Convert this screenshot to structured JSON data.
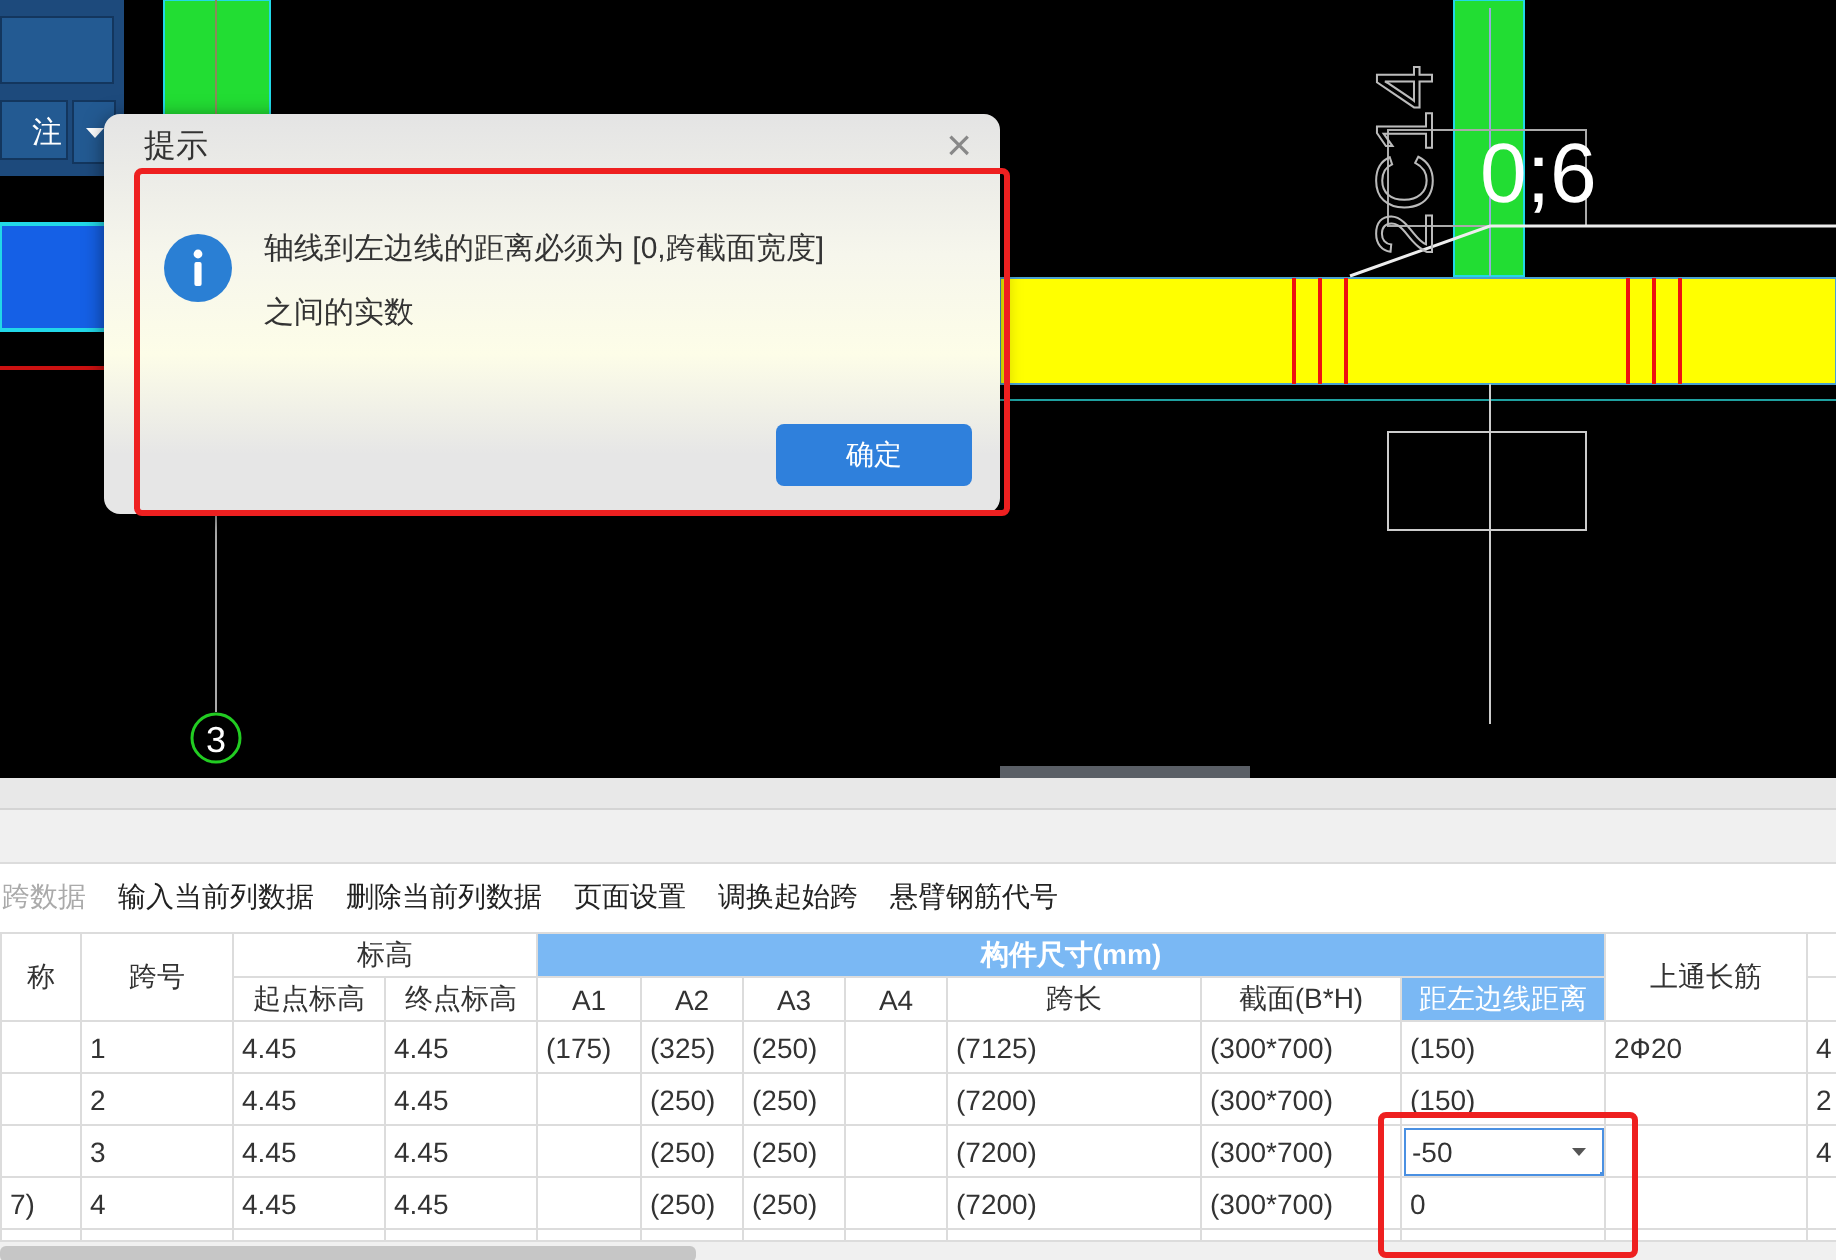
{
  "cad": {
    "toolbar": {
      "button_label": "注"
    },
    "labels": [
      {
        "kind": "dimension",
        "text": "0;6"
      },
      {
        "kind": "rebar",
        "text": "2C14"
      },
      {
        "kind": "axis",
        "text": "3"
      }
    ]
  },
  "dialog": {
    "title": "提示",
    "close": "×",
    "message_lines": [
      "轴线到左边线的距离必须为 [0,跨截面宽度]",
      "之间的实数"
    ],
    "buttons": [
      "确定"
    ]
  },
  "toolbar": [
    {
      "label": "跨数据",
      "disabled": true
    },
    {
      "label": "输入当前列数据",
      "disabled": false
    },
    {
      "label": "删除当前列数据",
      "disabled": false
    },
    {
      "label": "页面设置",
      "disabled": false
    },
    {
      "label": "调换起始跨",
      "disabled": false
    },
    {
      "label": "悬臂钢筋代号",
      "disabled": false
    }
  ],
  "table": {
    "header_rows": [
      [
        {
          "text": "称",
          "rowspan": 2,
          "highlighted": false
        },
        {
          "text": "跨号",
          "rowspan": 2,
          "highlighted": false
        },
        {
          "text": "标高",
          "colspan": 2,
          "highlighted": false
        },
        {
          "text": "构件尺寸(mm)",
          "colspan": 7,
          "highlighted": true
        },
        {
          "text": "上通长筋",
          "rowspan": 2,
          "highlighted": false
        }
      ],
      [
        {
          "text": "起点标高",
          "highlighted": false
        },
        {
          "text": "终点标高",
          "highlighted": false
        },
        {
          "text": "A1",
          "highlighted": false
        },
        {
          "text": "A2",
          "highlighted": false
        },
        {
          "text": "A3",
          "highlighted": false
        },
        {
          "text": "A4",
          "highlighted": false
        },
        {
          "text": "跨长",
          "highlighted": false
        },
        {
          "text": "截面(B*H)",
          "highlighted": false
        },
        {
          "text": "距左边线距离",
          "highlighted": true
        }
      ]
    ],
    "rows": [
      {
        "selected": false,
        "cells": [
          null,
          "1",
          "4.45",
          "4.45",
          "(175)",
          "(325)",
          "(250)",
          null,
          "(7125)",
          "(300*700)",
          "(150)",
          "2Ф20",
          "4"
        ]
      },
      {
        "selected": false,
        "cells": [
          null,
          "2",
          "4.45",
          "4.45",
          null,
          "(250)",
          "(250)",
          null,
          "(7200)",
          "(300*700)",
          "(150)",
          null,
          "2"
        ]
      },
      {
        "selected": true,
        "cells": [
          null,
          "3",
          "4.45",
          "4.45",
          null,
          "(250)",
          "(250)",
          null,
          "(7200)",
          "(300*700)",
          "-50",
          null,
          "4"
        ]
      },
      {
        "selected": false,
        "cells": [
          "7)",
          "4",
          "4.45",
          "4.45",
          null,
          "(250)",
          "(250)",
          null,
          "(7200)",
          "(300*700)",
          "0",
          null,
          null
        ]
      }
    ]
  }
}
